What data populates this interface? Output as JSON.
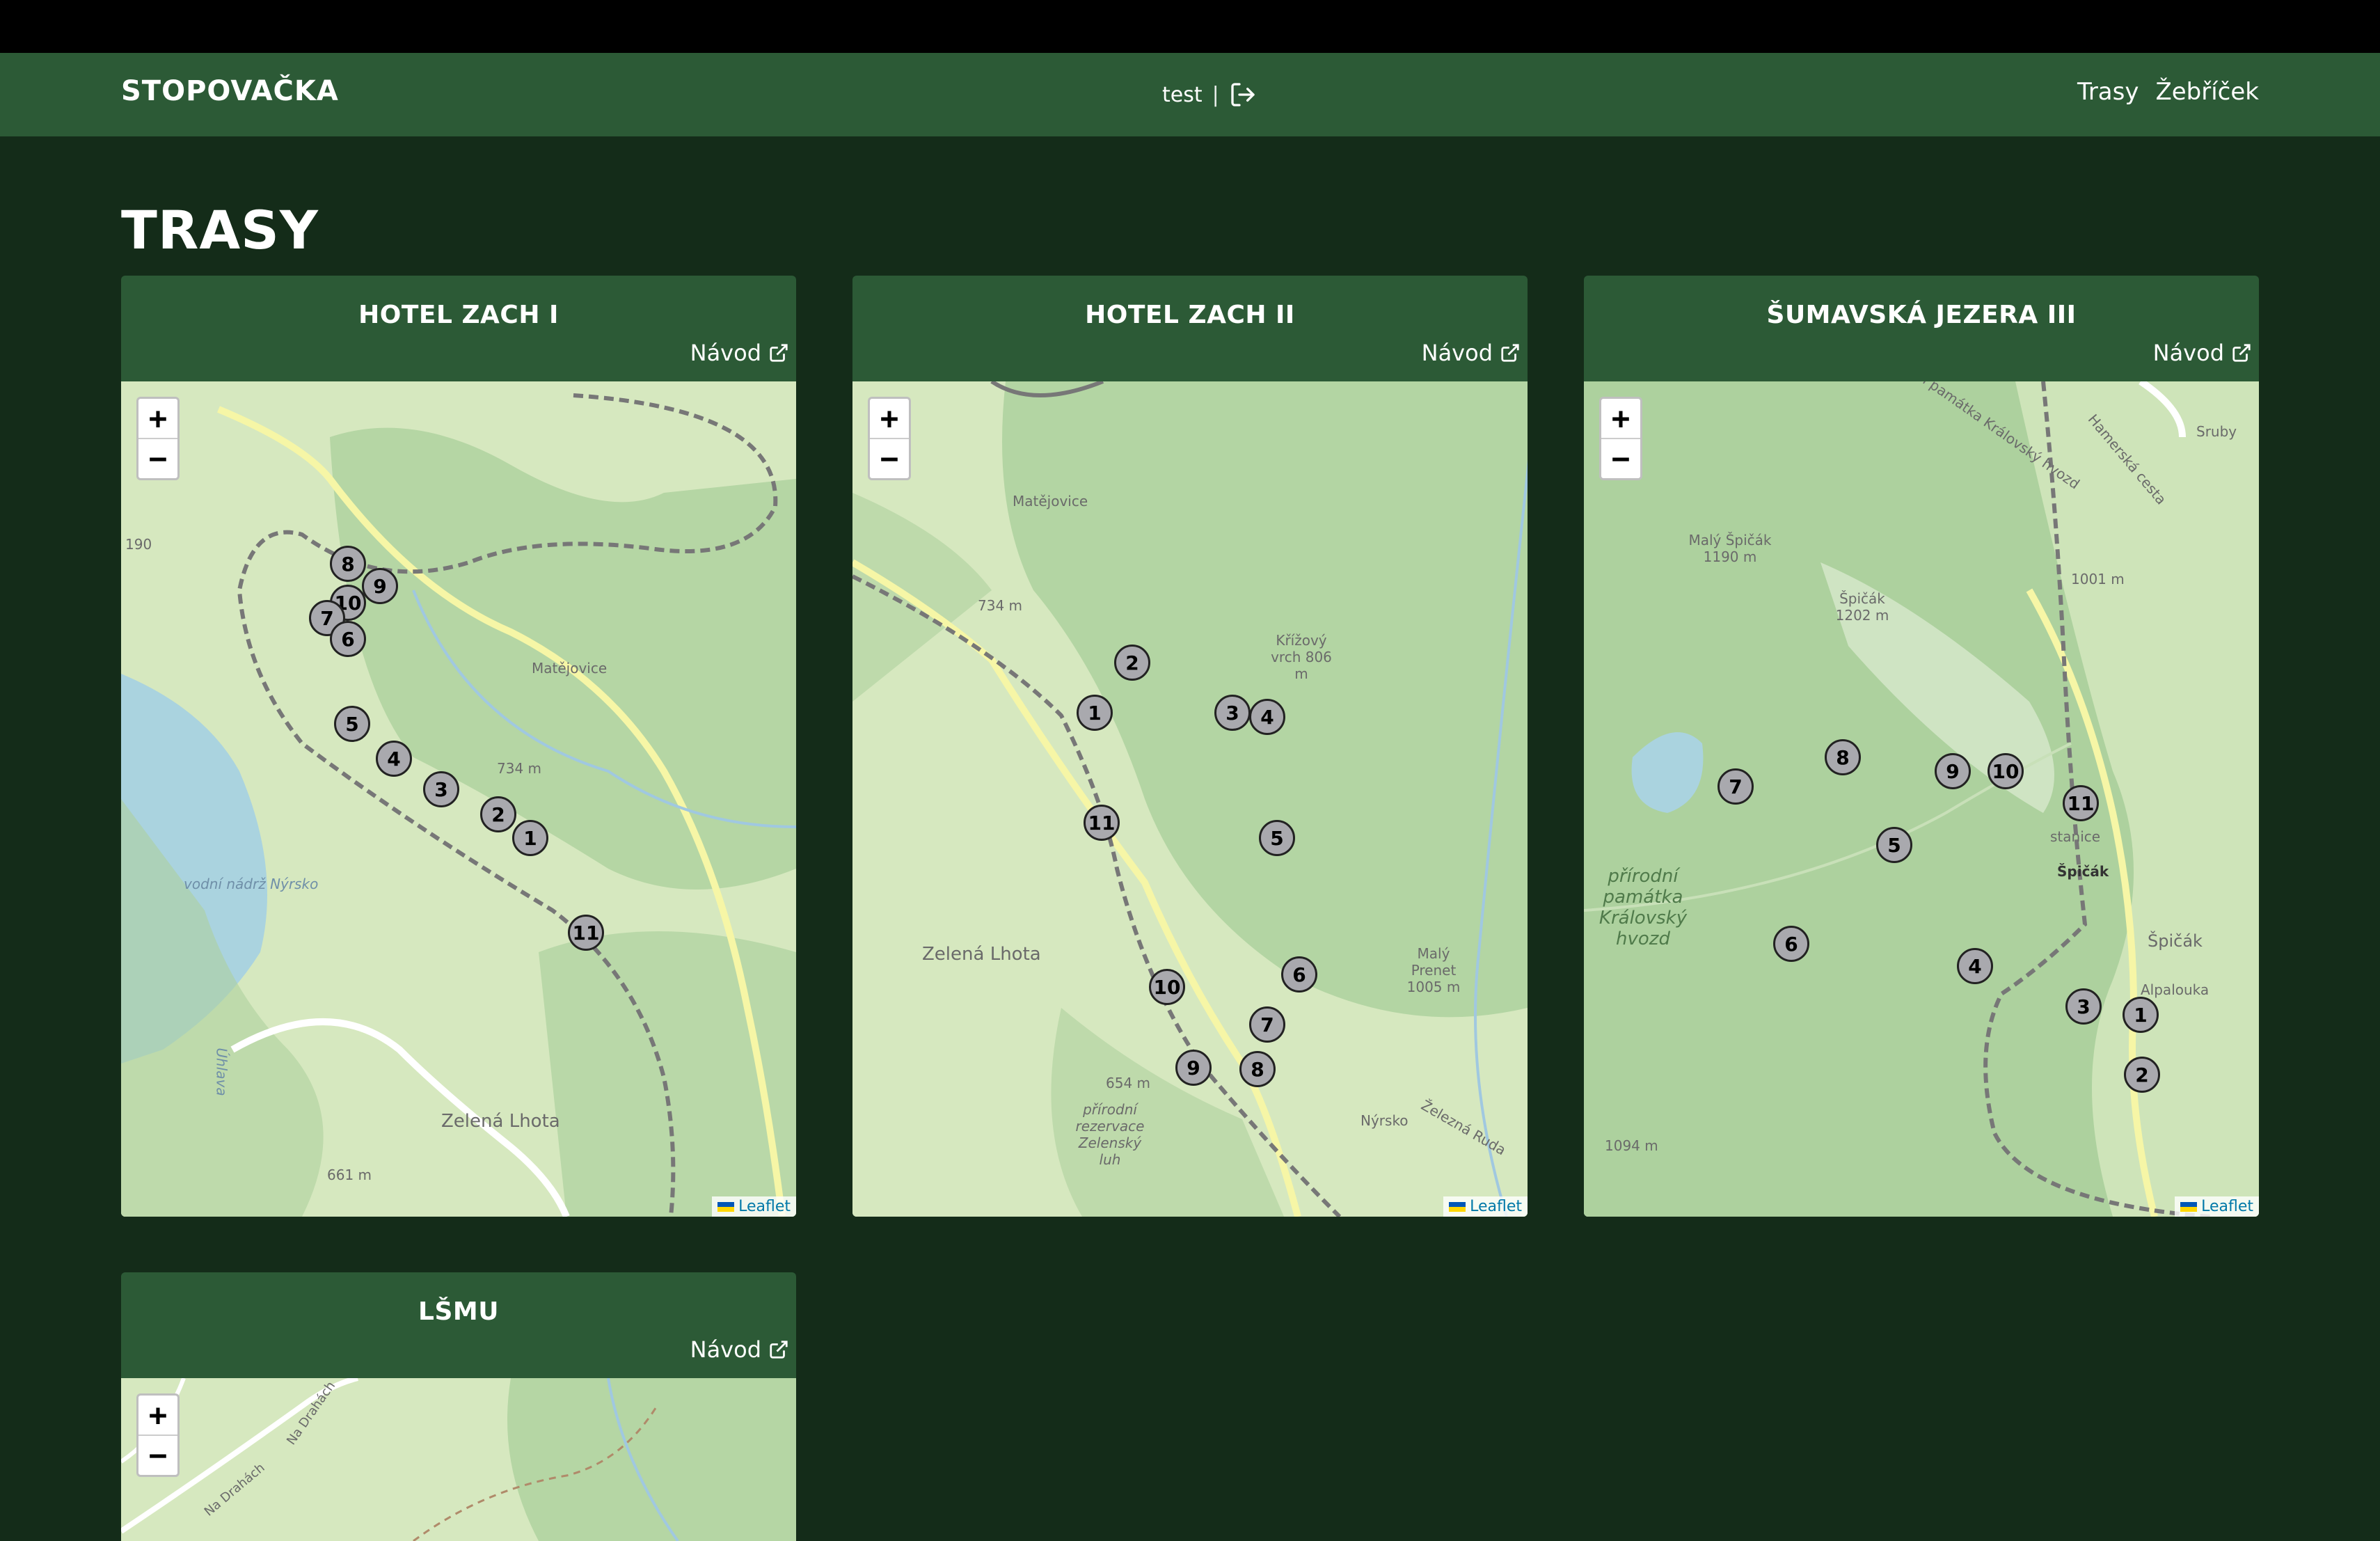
{
  "navbar": {
    "brand": "STOPOVAČKA",
    "user": "test",
    "separator": "|",
    "links": [
      "Trasy",
      "Žebříček"
    ]
  },
  "page": {
    "title": "TRASY"
  },
  "map_common": {
    "zoom_in": "+",
    "zoom_out": "−",
    "attribution": "Leaflet"
  },
  "routes": [
    {
      "name": "HOTEL ZACH I",
      "guide_label": "Návod",
      "labels": [
        "190",
        "Matějovice",
        "734 m",
        "vodní nádrž Nýrsko",
        "Zelená Lhota",
        "661 m",
        "Úhlava"
      ],
      "markers": [
        {
          "label": "8"
        },
        {
          "label": "9"
        },
        {
          "label": "10"
        },
        {
          "label": "7"
        },
        {
          "label": "6"
        },
        {
          "label": "5"
        },
        {
          "label": "4"
        },
        {
          "label": "3"
        },
        {
          "label": "2"
        },
        {
          "label": "1"
        },
        {
          "label": "11"
        }
      ]
    },
    {
      "name": "HOTEL ZACH II",
      "guide_label": "Návod",
      "labels": [
        "Matějovice",
        "734 m",
        "Křížový vrch 806 m",
        "Zelená Lhota",
        "Malý Prenet 1005 m",
        "654 m",
        "přírodní rezervace Zelenský luh",
        "Nýrsko",
        "Železná Ruda"
      ],
      "markers": [
        {
          "label": "2"
        },
        {
          "label": "1"
        },
        {
          "label": "3"
        },
        {
          "label": "4"
        },
        {
          "label": "11"
        },
        {
          "label": "5"
        },
        {
          "label": "6"
        },
        {
          "label": "10"
        },
        {
          "label": "7"
        },
        {
          "label": "9"
        },
        {
          "label": "8"
        }
      ]
    },
    {
      "name": "ŠUMAVSKÁ JEZERA III",
      "guide_label": "Návod",
      "labels": [
        "přírodní památka Královský hvozd",
        "Sruby",
        "Hamerská cesta",
        "Malý Špičák 1190 m",
        "Špičák 1202 m",
        "1001 m",
        "přírodní památka Královský hvozd",
        "Špičák",
        "Špičák",
        "Alpalouka",
        "1094 m",
        "stanice"
      ],
      "markers": [
        {
          "label": "8"
        },
        {
          "label": "7"
        },
        {
          "label": "9"
        },
        {
          "label": "10"
        },
        {
          "label": "11"
        },
        {
          "label": "5"
        },
        {
          "label": "6"
        },
        {
          "label": "4"
        },
        {
          "label": "3"
        },
        {
          "label": "1"
        },
        {
          "label": "2"
        }
      ]
    },
    {
      "name": "LŠMU",
      "guide_label": "Návod",
      "labels": [
        "Na Drahách",
        "Na Drahách"
      ],
      "markers": []
    }
  ]
}
